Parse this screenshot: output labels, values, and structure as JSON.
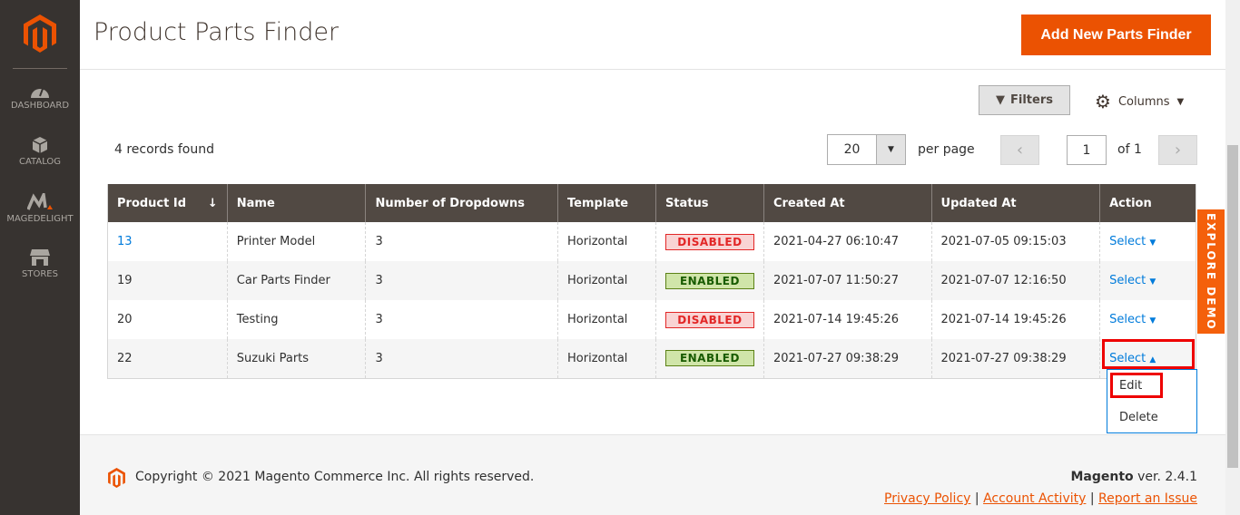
{
  "sidebar": {
    "items": [
      {
        "label": "DASHBOARD"
      },
      {
        "label": "CATALOG"
      },
      {
        "label": "MAGEDELIGHT"
      },
      {
        "label": "STORES"
      }
    ]
  },
  "header": {
    "title": "Product Parts Finder",
    "add_button": "Add New Parts Finder"
  },
  "toolbar": {
    "filters": "Filters",
    "columns": "Columns",
    "records": "4 records found",
    "per_page_value": "20",
    "per_page_label": "per page",
    "page": "1",
    "of": "of 1"
  },
  "table": {
    "columns": [
      "Product Id",
      "Name",
      "Number of Dropdowns",
      "Template",
      "Status",
      "Created At",
      "Updated At",
      "Action"
    ],
    "rows": [
      {
        "id": "13",
        "name": "Printer Model",
        "dropdowns": "3",
        "template": "Horizontal",
        "status": "DISABLED",
        "created": "2021-04-27 06:10:47",
        "updated": "2021-07-05 09:15:03",
        "action": "Select"
      },
      {
        "id": "19",
        "name": "Car Parts Finder",
        "dropdowns": "3",
        "template": "Horizontal",
        "status": "ENABLED",
        "created": "2021-07-07 11:50:27",
        "updated": "2021-07-07 12:16:50",
        "action": "Select"
      },
      {
        "id": "20",
        "name": "Testing",
        "dropdowns": "3",
        "template": "Horizontal",
        "status": "DISABLED",
        "created": "2021-07-14 19:45:26",
        "updated": "2021-07-14 19:45:26",
        "action": "Select"
      },
      {
        "id": "22",
        "name": "Suzuki Parts",
        "dropdowns": "3",
        "template": "Horizontal",
        "status": "ENABLED",
        "created": "2021-07-27 09:38:29",
        "updated": "2021-07-27 09:38:29",
        "action": "Select"
      }
    ]
  },
  "action_menu": {
    "items": [
      "Edit",
      "Delete"
    ]
  },
  "explore_demo": "EXPLORE DEMO",
  "footer": {
    "copyright": "Copyright © 2021 Magento Commerce Inc. All rights reserved.",
    "brand": "Magento",
    "version": " ver. 2.4.1",
    "links": [
      "Privacy Policy",
      "Account Activity",
      "Report an Issue"
    ]
  },
  "colors": {
    "accent": "#eb5202",
    "sidebar": "#373330",
    "table_header": "#514943"
  }
}
